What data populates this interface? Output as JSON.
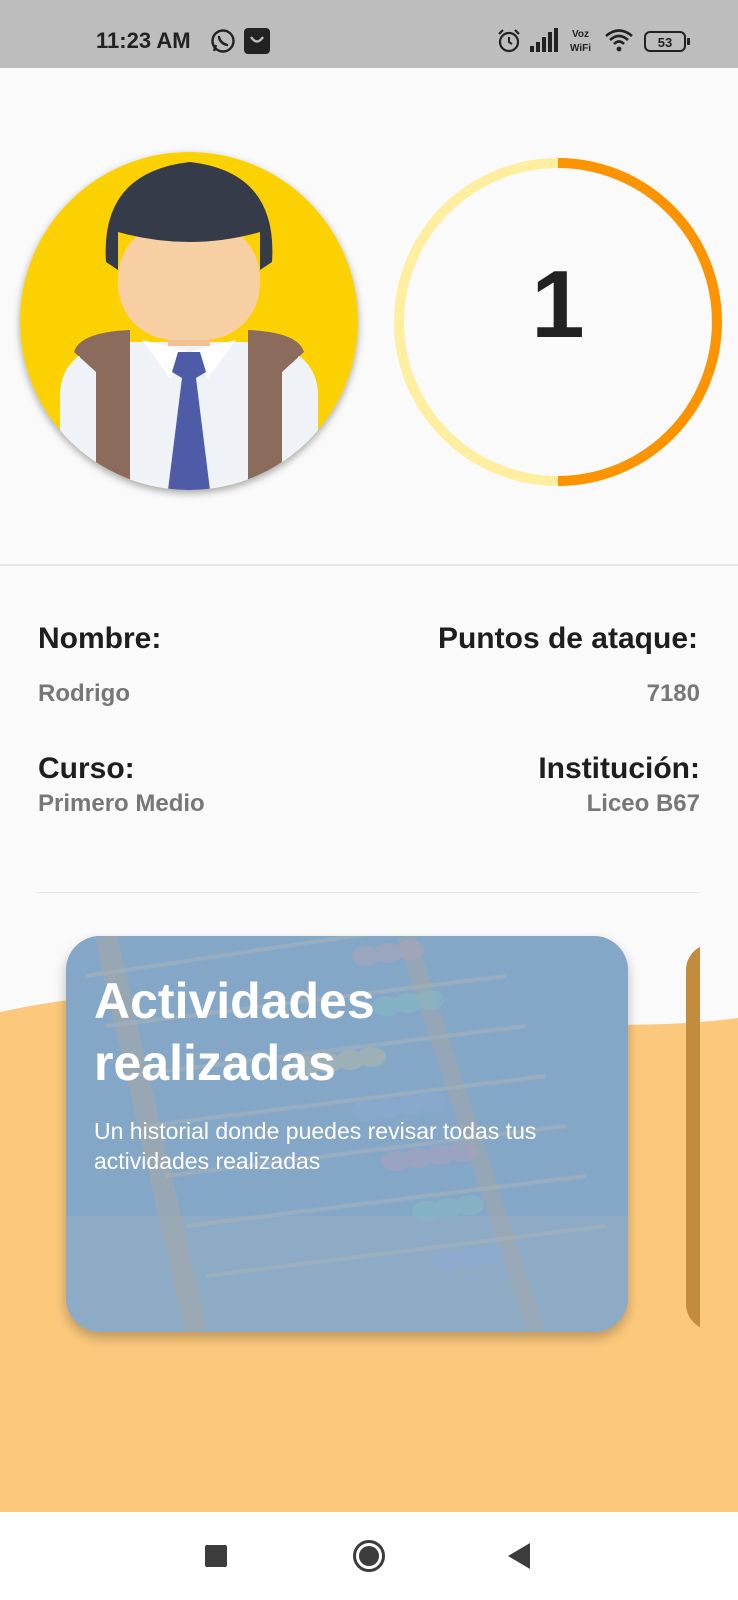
{
  "status_bar": {
    "time": "11:23 AM",
    "voz_label_top": "Voz",
    "voz_label_bottom": "WiFi",
    "battery": "53",
    "icons": [
      "whatsapp-icon",
      "shopping-bag-icon",
      "alarm-icon",
      "signal-icon",
      "voz-wifi-icon",
      "wifi-icon",
      "battery-icon"
    ]
  },
  "profile": {
    "level": "1",
    "level_progress": 0.5,
    "colors": {
      "ring_track": "#fdeea0",
      "ring_progress": "#fb9400",
      "avatar_bg": "#fbd102"
    }
  },
  "info": {
    "name_label": "Nombre:",
    "name_value": "Rodrigo",
    "attack_label": "Puntos de ataque:",
    "attack_value": "7180",
    "course_label": "Curso:",
    "course_value": "Primero Medio",
    "institution_label": "Institución:",
    "institution_value": "Liceo B67"
  },
  "cards": [
    {
      "title": "Actividades realizadas",
      "description": "Un historial donde puedes revisar todas tus actividades realizadas"
    }
  ],
  "nav": {
    "buttons": [
      "recents-icon",
      "home-icon",
      "back-icon"
    ]
  },
  "colors": {
    "wave": "#fcc97c",
    "card_tint": "#7fa5c8"
  }
}
